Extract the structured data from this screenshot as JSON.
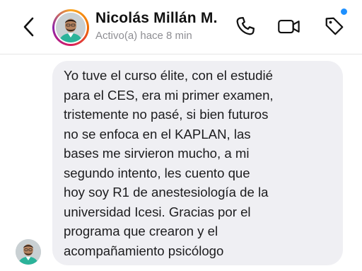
{
  "header": {
    "contact_name": "Nicolás Millán M.",
    "status": "Activo(a) hace 8 min",
    "icons": [
      "back-chevron-icon",
      "phone-icon",
      "video-camera-icon",
      "tag-icon"
    ],
    "accent_color": "#1e90ff"
  },
  "conversation": {
    "messages": [
      {
        "from": "contact",
        "text": "Yo tuve el curso élite, con el estudié\npara el CES, era mi primer examen,\ntristemente no pasé, si bien futuros\nno se enfoca en el KAPLAN, las\nbases me sirvieron mucho, a mi\nsegundo intento, les cuento que\nhoy soy R1 de anestesiología de la\nuniversidad Icesi. Gracias por el\nprograma que crearon y el\nacompañamiento psicólogo"
      }
    ]
  }
}
